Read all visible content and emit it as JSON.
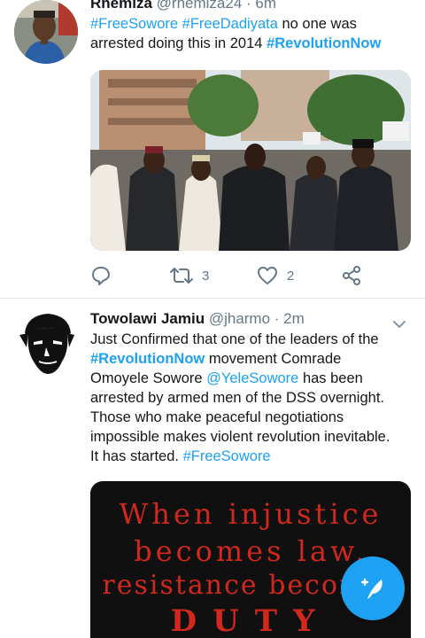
{
  "tweets": [
    {
      "name": "Rhemiza",
      "handle": "@rhemiza24",
      "sep": " · ",
      "time": "6m",
      "text_parts": {
        "h1": "#FreeSowore",
        "h2": "#FreeDadiyata",
        "t1": " no one was arrested doing this in 2014 ",
        "h3": "#RevolutionNow"
      },
      "actions": {
        "reply_count": "",
        "retweet_count": "3",
        "like_count": "2"
      }
    },
    {
      "name": "Towolawi Jamiu",
      "handle": "@jharmo",
      "sep": " · ",
      "time": "2m",
      "text_parts": {
        "t1": "Just Confirmed that one of the leaders of the ",
        "h1": "#RevolutionNow",
        "t2": " movement Comrade Omoyele Sowore ",
        "m1": "@YeleSowore",
        "t3": " has been arrested by armed men of the DSS overnight. Those who make peaceful negotiations impossible makes violent revolution inevitable. It has started. ",
        "h2": "#FreeSowore"
      },
      "poster": {
        "line1": "When injustice",
        "line2": "becomes law,",
        "line3": "resistance becomes",
        "line4": "DUTY"
      }
    }
  ],
  "icons": {
    "reply": "reply-icon",
    "retweet": "retweet-icon",
    "like": "heart-icon",
    "share": "share-icon",
    "caret": "chevron-down-icon",
    "compose": "compose-tweet-icon"
  },
  "colors": {
    "link": "#1da1f2",
    "meta": "#657786",
    "text": "#14171a",
    "divider": "#e1e8ed",
    "fab": "#1da1f2",
    "poster_text": "#d0281c"
  }
}
